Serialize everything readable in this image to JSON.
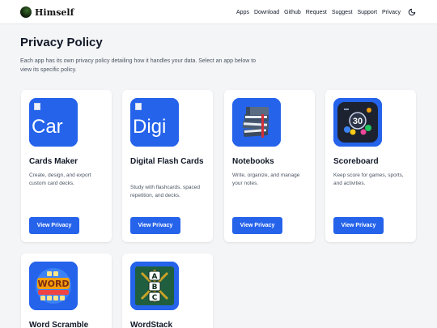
{
  "brand": {
    "name": "Himself"
  },
  "nav": {
    "links": [
      "Apps",
      "Download",
      "Github",
      "Request",
      "Suggest",
      "Support",
      "Privacy"
    ],
    "theme_toggle_icon": "moon-icon"
  },
  "page": {
    "title": "Privacy Policy",
    "description": "Each app has its own privacy policy detailing how it handles your data. Select an app below to view its specific policy."
  },
  "apps": [
    {
      "title": "Cards Maker",
      "description": "Create, design, and export custom card decks.",
      "icon_alt": "Car",
      "button": "View Privacy"
    },
    {
      "title": "Digital Flash Cards",
      "description": "Study with flashcards, spaced repetition, and decks.",
      "icon_alt": "Digi",
      "button": "View Privacy"
    },
    {
      "title": "Notebooks",
      "description": "Write, organize, and manage your notes.",
      "icon": "notebooks-icon",
      "button": "View Privacy"
    },
    {
      "title": "Scoreboard",
      "description": "Keep score for games, sports, and activities.",
      "icon": "scoreboard-icon",
      "icon_text": "30",
      "button": "View Privacy"
    },
    {
      "title": "Word Scramble",
      "icon": "word-scramble-icon",
      "icon_text": "WORD"
    },
    {
      "title": "WordStack",
      "icon": "wordstack-icon",
      "icon_text": [
        "A",
        "B",
        "C"
      ]
    }
  ],
  "colors": {
    "accent": "#2563eb",
    "background": "#f4f5f7",
    "card": "#ffffff"
  }
}
